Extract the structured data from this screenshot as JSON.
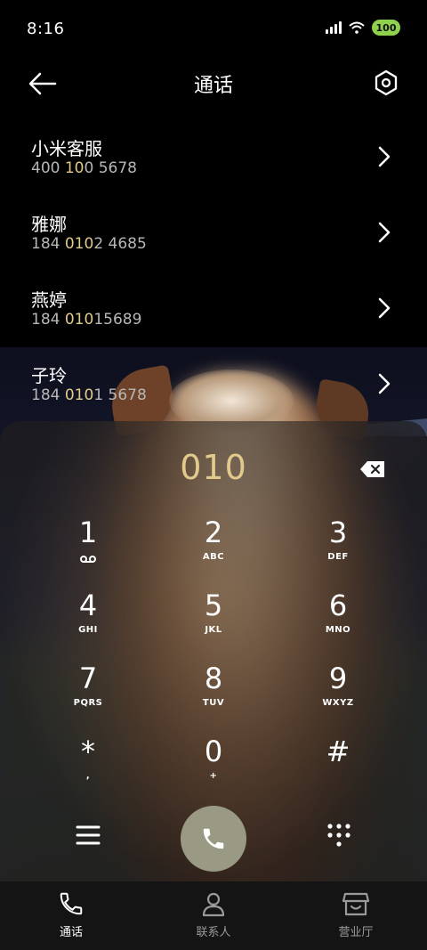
{
  "status": {
    "time": "8:16",
    "battery": "100"
  },
  "header": {
    "title": "通话"
  },
  "contacts": [
    {
      "name": "小米客服",
      "num_pre": "400 ",
      "num_hl": "10",
      "num_post": "0 5678"
    },
    {
      "name": "雅娜",
      "num_pre": "184 ",
      "num_hl": "010",
      "num_post": "2 4685"
    },
    {
      "name": "燕婷",
      "num_pre": "184 ",
      "num_hl": "010",
      "num_post": "15689"
    },
    {
      "name": "子玲",
      "num_pre": "184 ",
      "num_hl": "010",
      "num_post": "1 5678"
    }
  ],
  "dialer": {
    "entered": "010"
  },
  "keys": [
    {
      "digit": "1",
      "letters": ""
    },
    {
      "digit": "2",
      "letters": "ABC"
    },
    {
      "digit": "3",
      "letters": "DEF"
    },
    {
      "digit": "4",
      "letters": "GHI"
    },
    {
      "digit": "5",
      "letters": "JKL"
    },
    {
      "digit": "6",
      "letters": "MNO"
    },
    {
      "digit": "7",
      "letters": "PQRS"
    },
    {
      "digit": "8",
      "letters": "TUV"
    },
    {
      "digit": "9",
      "letters": "WXYZ"
    },
    {
      "digit": "*",
      "letters": ","
    },
    {
      "digit": "0",
      "letters": "+"
    },
    {
      "digit": "#",
      "letters": ""
    }
  ],
  "nav": {
    "calls": "通话",
    "contacts": "联系人",
    "store": "营业厅"
  },
  "colors": {
    "highlight": "#e2c98c",
    "call_button": "#9a9a84",
    "battery": "#8fd14f"
  }
}
